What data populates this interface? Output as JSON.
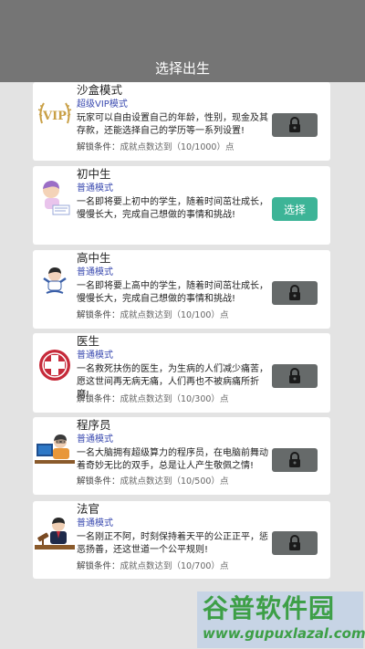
{
  "header": {
    "title": "选择出生"
  },
  "cards": [
    {
      "name": "沙盒模式",
      "mode": "超级VIP模式",
      "desc": "玩家可以自由设置自己的年龄，性别，现金及其存款，还能选择自己的学历等一系列设置!",
      "cond_label": "解锁条件：",
      "cond_value": "成就点数达到（10/1000）点",
      "button": "lock",
      "thumb_icon": "vip-icon",
      "thumb_text": "VIP"
    },
    {
      "name": "初中生",
      "mode": "普通模式",
      "desc": "一名即将要上初中的学生，随着时间茁壮成长，慢慢长大，完成自己想做的事情和挑战!",
      "button": "select",
      "select_label": "选择",
      "thumb_icon": "student-icon"
    },
    {
      "name": "高中生",
      "mode": "普通模式",
      "desc": "一名即将要上高中的学生，随着时间茁壮成长，慢慢长大，完成自己想做的事情和挑战!",
      "cond_label": "解锁条件：",
      "cond_value": "成就点数达到（10/100）点",
      "button": "lock",
      "thumb_icon": "high-school-student-icon"
    },
    {
      "name": "医生",
      "mode": "普通模式",
      "desc": "一名救死扶伤的医生，为生病的人们减少痛苦，愿这世间再无病无痛，人们再也不被病痛所折磨!",
      "cond_label": "解锁条件：",
      "cond_value": "成就点数达到（10/300）点",
      "button": "lock",
      "thumb_icon": "medical-cross-icon"
    },
    {
      "name": "程序员",
      "mode": "普通模式",
      "desc": "一名大脑拥有超级算力的程序员，在电脑前舞动着奇妙无比的双手，总是让人产生敬佩之情!",
      "cond_label": "解锁条件：",
      "cond_value": "成就点数达到（10/500）点",
      "button": "lock",
      "thumb_icon": "programmer-icon"
    },
    {
      "name": "法官",
      "mode": "普通模式",
      "desc": "一名刚正不阿，时刻保持着天平的公正正平，惩恶扬善，还这世道一个公平规则!",
      "cond_label": "解锁条件：",
      "cond_value": "成就点数达到（10/700）点",
      "button": "lock",
      "thumb_icon": "judge-icon"
    }
  ],
  "colors": {
    "header": "#757575",
    "lock": "#666a6a",
    "select": "#3db497",
    "mode": "#3b4bb0"
  },
  "watermark": {
    "brand": "谷普软件园",
    "url": "www.gupuxlazal.com"
  }
}
